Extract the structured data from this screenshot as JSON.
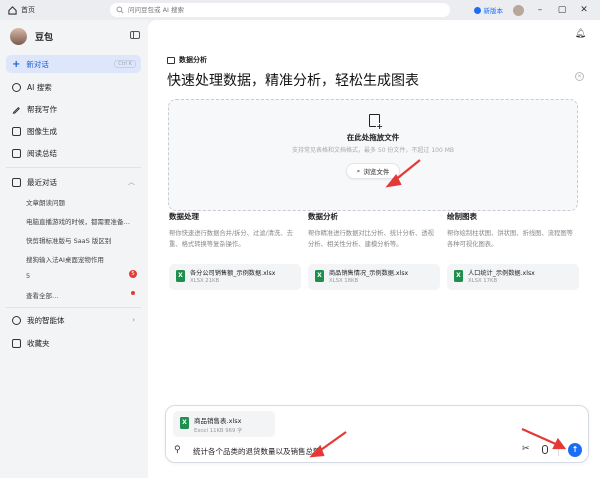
{
  "titlebar": {
    "home_tab": "首页",
    "search_placeholder": "问问豆包或 AI 搜索",
    "new_version": "新版本"
  },
  "sidebar": {
    "brand": "豆包",
    "new_chat": {
      "label": "新对话",
      "shortcut": "Ctrl K"
    },
    "nav": [
      {
        "label": "AI 搜索",
        "icon": "search-icon"
      },
      {
        "label": "帮我写作",
        "icon": "pen-icon"
      },
      {
        "label": "图像生成",
        "icon": "image-icon"
      },
      {
        "label": "阅读总结",
        "icon": "book-icon"
      }
    ],
    "recent_title": "最近对话",
    "history": [
      "文章朗读问题",
      "电脑直播游戏的时候，都需要准备…",
      "快剪辑标准版与 SaaS 版区别",
      "搜狗输入法AI桌面宠物作用",
      "5",
      "查看全部…"
    ],
    "history_badge": "5",
    "agents": "我的智能体",
    "favorites": "收藏夹"
  },
  "main": {
    "section_label": "数据分析",
    "headline": "快速处理数据，精准分析，轻松生成图表",
    "dropzone": {
      "title": "在此处拖放文件",
      "subtitle": "支持常见表格和文档格式，最多 50 份文件，不超过 100 MB",
      "browse": "浏览文件"
    },
    "columns": [
      {
        "title": "数据处理",
        "desc": "帮你快速进行数据合并/拆分、过滤/清洗、去重、格式转换等复杂操作。",
        "file": {
          "name": "各分公司销售额_示例数据.xlsx",
          "meta": "XLSX 21KB"
        }
      },
      {
        "title": "数据分析",
        "desc": "帮你精准进行数据对比分析、统计分析、透视分析、相关性分析、建模分析等。",
        "file": {
          "name": "商品销售情况_示例数据.xlsx",
          "meta": "XLSX 18KB"
        }
      },
      {
        "title": "绘制图表",
        "desc": "帮你绘制柱状图、饼状图、折线图、流程图等各种可视化图表。",
        "file": {
          "name": "人口统计_示例数据.xlsx",
          "meta": "XLSX 17KB"
        }
      }
    ]
  },
  "composer": {
    "attachment": {
      "name": "商品销售表.xlsx",
      "meta": "Excel 11KB 969 字"
    },
    "prompt": "统计各个品类的退货数量以及销售总额"
  },
  "colors": {
    "accent": "#1a6ef5",
    "annotation_arrow": "#e53935",
    "excel": "#1f8f4e"
  }
}
